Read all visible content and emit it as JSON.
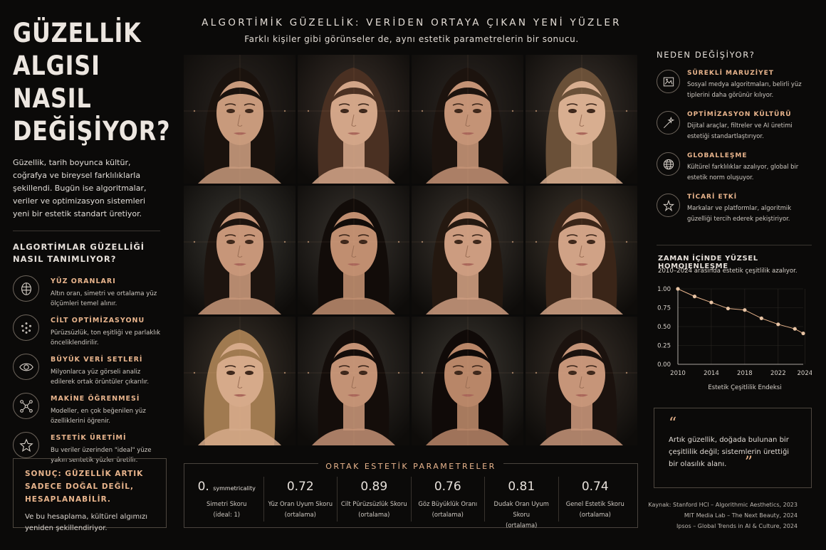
{
  "left": {
    "title_lines": [
      "GÜZELLİK",
      "ALGISI",
      "NASIL",
      "DEĞİŞİYOR?"
    ],
    "intro": "Güzellik, tarih boyunca kültür, coğrafya ve bireysel farklılıklarla şekillendi. Bugün ise algoritmalar, veriler ve optimizasyon sistemleri yeni bir estetik standart üretiyor.",
    "algo_title": "ALGORTİMLAR GÜZELLİĞİ NASIL TANIMLIYOR?",
    "algo_items": [
      {
        "icon": "face-grid-icon",
        "head": "YÜZ ORANLARI",
        "desc": "Altın oran, simetri ve ortalama yüz ölçümleri temel alınır."
      },
      {
        "icon": "dots-circle-icon",
        "head": "CİLT OPTİMİZASYONU",
        "desc": "Pürüzsüzlük, ton eşitliği ve parlaklık önceliklendirilir."
      },
      {
        "icon": "eye-icon",
        "head": "BÜYÜK VERİ SETLERİ",
        "desc": "Milyonlarca yüz görseli analiz edilerek ortak örüntüler çıkarılır."
      },
      {
        "icon": "network-icon",
        "head": "MAKİNE ÖĞRENMESİ",
        "desc": "Modeller, en çok beğenilen yüz özelliklerini öğrenir."
      },
      {
        "icon": "star-icon",
        "head": "ESTETİK ÜRETİMİ",
        "desc": "Bu veriler üzerinden \"ideal\" yüze yakın sentetik yüzler üretilir."
      }
    ],
    "conclusion_title": "SONUÇ: GÜZELLİK ARTIK SADECE DOĞAL DEĞİL, HESAPLANABİLİR.",
    "conclusion_text": "Ve bu hesaplama, kültürel algımızı yeniden şekillendiriyor."
  },
  "center": {
    "title": "ALGORTİMİK GÜZELLİK: VERİDEN ORTAYA ÇIKAN YENİ YÜZLER",
    "subtitle": "Farklı kişiler gibi görünseler de, aynı estetik parametrelerin bir sonucu.",
    "faces": [
      {
        "hair": "#1a120d",
        "skin": "#c89a7c",
        "bg": "#2a2420"
      },
      {
        "hair": "#4a3022",
        "skin": "#d2a588",
        "bg": "#3a302a"
      },
      {
        "hair": "#1c130e",
        "skin": "#c49376",
        "bg": "#2c2622"
      },
      {
        "hair": "#6a5038",
        "skin": "#d8ae90",
        "bg": "#3a322c"
      },
      {
        "hair": "#1d140f",
        "skin": "#c79679",
        "bg": "#3a3833"
      },
      {
        "hair": "#120c09",
        "skin": "#c08e70",
        "bg": "#3a3530"
      },
      {
        "hair": "#241810",
        "skin": "#cc9c80",
        "bg": "#3c3630"
      },
      {
        "hair": "#3a2518",
        "skin": "#d0a286",
        "bg": "#40382f"
      },
      {
        "hair": "#a07a50",
        "skin": "#d6aa8a",
        "bg": "#3a322a"
      },
      {
        "hair": "#140d0a",
        "skin": "#c39275",
        "bg": "#35302b"
      },
      {
        "hair": "#100a08",
        "skin": "#b88668",
        "bg": "#3a3630"
      },
      {
        "hair": "#1b120e",
        "skin": "#c69579",
        "bg": "#383029"
      }
    ],
    "params_title": "ORTAK ESTETİK PARAMETRELER",
    "params": [
      {
        "value": "0.",
        "value_small": "symmetricality",
        "label": "Simetri Skoru",
        "label2": "(ideal: 1)"
      },
      {
        "value": "0.72",
        "value_small": "",
        "label": "Yüz Oran Uyum Skoru",
        "label2": "(ortalama)"
      },
      {
        "value": "0.89",
        "value_small": "",
        "label": "Cilt Pürüzsüzlük Skoru",
        "label2": "(ortalama)"
      },
      {
        "value": "0.76",
        "value_small": "",
        "label": "Göz Büyüklük Oranı",
        "label2": "(ortalama)"
      },
      {
        "value": "0.81",
        "value_small": "",
        "label": "Dudak Oran Uyum Skoru",
        "label2": "(ortalama)"
      },
      {
        "value": "0.74",
        "value_small": "",
        "label": "Genel Estetik Skoru",
        "label2": "(ortalama)"
      }
    ]
  },
  "right": {
    "why_title": "NEDEN DEĞİŞİYOR?",
    "why_items": [
      {
        "icon": "image-frame-icon",
        "head": "SÜREKLİ MARUZİYET",
        "desc": "Sosyal medya algoritmaları, belirli yüz tiplerini daha görünür kılıyor."
      },
      {
        "icon": "magic-wand-icon",
        "head": "OPTİMİZASYON KÜLTÜRÜ",
        "desc": "Dijital araçlar, filtreler ve AI üretimi estetiği standartlaştırıyor."
      },
      {
        "icon": "globe-icon",
        "head": "GLOBALLEŞME",
        "desc": "Kültürel farklılıklar azalıyor, global bir estetik norm oluşuyor."
      },
      {
        "icon": "brand-star-icon",
        "head": "TİCARİ ETKİ",
        "desc": "Markalar ve platformlar, algoritmik güzelliği tercih ederek pekiştiriyor."
      }
    ],
    "quote_open": "“",
    "quote_text": "Artık güzellik, doğada bulunan bir çeşitlilik değil; sistemlerin ürettiği bir olasılık alanı.",
    "quote_close": "”",
    "sources": [
      "Kaynak: Stanford HCI – Algorithmic Aesthetics, 2023",
      "MIT Media Lab – The Next Beauty, 2024",
      "Ipsos – Global Trends in AI & Culture, 2024"
    ]
  },
  "colors": {
    "accent": "#e8b48c",
    "background": "#0b0a09"
  },
  "chart_data": {
    "type": "line",
    "title": "ZAMAN İÇİNDE YÜZSEL HOMOJENLEŞME",
    "subtitle": "2010–2024 arasında estetik çeşitlilik azalıyor.",
    "xlabel": "Estetik Çeşitlilik Endeksi",
    "ylabel": "",
    "x": [
      2010,
      2012,
      2014,
      2016,
      2018,
      2020,
      2022,
      2024,
      2025
    ],
    "y": [
      1.0,
      0.9,
      0.82,
      0.74,
      0.72,
      0.61,
      0.53,
      0.47,
      0.41
    ],
    "xlim": [
      2010,
      2025
    ],
    "ylim": [
      0,
      1
    ],
    "xticks": [
      "2010",
      "2014",
      "2018",
      "2022",
      "2024"
    ],
    "xtick_values": [
      2010,
      2014,
      2018,
      2022,
      2025.2
    ],
    "yticks": [
      "0.00",
      "0.25",
      "0.50",
      "0.75",
      "1.00"
    ],
    "ytick_values": [
      0,
      0.25,
      0.5,
      0.75,
      1.0
    ],
    "grid": true
  }
}
